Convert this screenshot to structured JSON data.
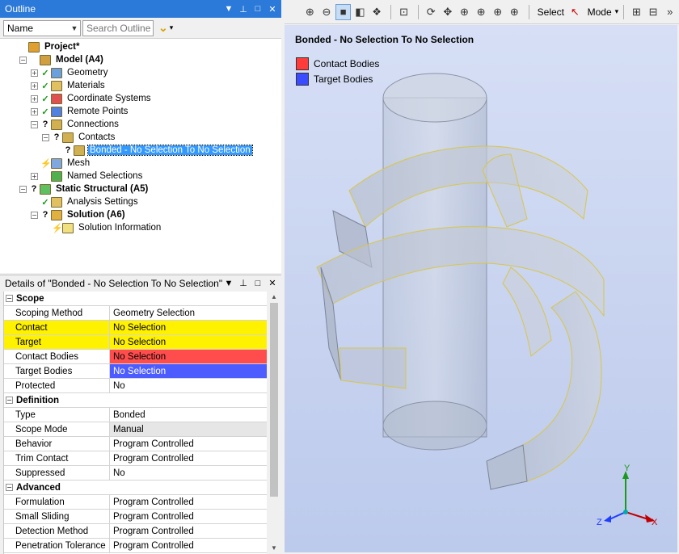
{
  "outline": {
    "title": "Outline",
    "pin_icon": "pin-icon",
    "filter_select": "Name",
    "search_placeholder": "Search Outline",
    "tree": [
      {
        "label": "Project*",
        "level": 0,
        "expander": "",
        "status": "",
        "icon": "project-icon",
        "bold": true
      },
      {
        "label": "Model (A4)",
        "level": 1,
        "expander": "−",
        "status": "",
        "icon": "model-icon",
        "bold": true
      },
      {
        "label": "Geometry",
        "level": 2,
        "expander": "+",
        "status": "✓",
        "icon": "geometry-icon"
      },
      {
        "label": "Materials",
        "level": 2,
        "expander": "+",
        "status": "✓",
        "icon": "materials-icon"
      },
      {
        "label": "Coordinate Systems",
        "level": 2,
        "expander": "+",
        "status": "✓",
        "icon": "coordinate-systems-icon"
      },
      {
        "label": "Remote Points",
        "level": 2,
        "expander": "+",
        "status": "✓",
        "icon": "remote-points-icon"
      },
      {
        "label": "Connections",
        "level": 2,
        "expander": "−",
        "status": "?",
        "icon": "connections-icon"
      },
      {
        "label": "Contacts",
        "level": 3,
        "expander": "−",
        "status": "?",
        "icon": "contacts-icon"
      },
      {
        "label": "Bonded - No Selection To No Selection",
        "level": 4,
        "expander": "",
        "status": "?",
        "icon": "bonded-contact-icon",
        "selected": true
      },
      {
        "label": "Mesh",
        "level": 2,
        "expander": "",
        "status": "⚡",
        "icon": "mesh-icon"
      },
      {
        "label": "Named Selections",
        "level": 2,
        "expander": "+",
        "status": "",
        "icon": "named-selections-icon"
      },
      {
        "label": "Static Structural (A5)",
        "level": 1,
        "expander": "−",
        "status": "?",
        "icon": "static-structural-icon",
        "bold": true
      },
      {
        "label": "Analysis Settings",
        "level": 2,
        "expander": "",
        "status": "✓",
        "icon": "analysis-settings-icon"
      },
      {
        "label": "Solution (A6)",
        "level": 2,
        "expander": "−",
        "status": "?",
        "icon": "solution-icon",
        "bold": true
      },
      {
        "label": "Solution Information",
        "level": 3,
        "expander": "",
        "status": "⚡",
        "icon": "solution-information-icon"
      }
    ]
  },
  "details": {
    "title": "Details of \"Bonded - No Selection To No Selection\"",
    "rows": [
      {
        "type": "cat",
        "label": "Scope"
      },
      {
        "key": "Scoping Method",
        "value": "Geometry Selection"
      },
      {
        "key": "Contact",
        "value": "No Selection",
        "style": "yellow"
      },
      {
        "key": "Target",
        "value": "No Selection",
        "style": "yellow"
      },
      {
        "key": "Contact Bodies",
        "value": "No Selection",
        "style": "red"
      },
      {
        "key": "Target Bodies",
        "value": "No Selection",
        "style": "blue"
      },
      {
        "key": "Protected",
        "value": "No"
      },
      {
        "type": "cat",
        "label": "Definition"
      },
      {
        "key": "Type",
        "value": "Bonded"
      },
      {
        "key": "Scope Mode",
        "value": "Manual",
        "style": "grey"
      },
      {
        "key": "Behavior",
        "value": "Program Controlled"
      },
      {
        "key": "Trim Contact",
        "value": "Program Controlled"
      },
      {
        "key": "Suppressed",
        "value": "No"
      },
      {
        "type": "cat",
        "label": "Advanced"
      },
      {
        "key": "Formulation",
        "value": "Program Controlled"
      },
      {
        "key": "Small Sliding",
        "value": "Program Controlled"
      },
      {
        "key": "Detection Method",
        "value": "Program Controlled"
      },
      {
        "key": "Penetration Tolerance",
        "value": "Program Controlled"
      }
    ]
  },
  "graphics_toolbar": {
    "select_label": "Select",
    "mode_label": "Mode"
  },
  "viewport": {
    "title": "Bonded - No Selection To No Selection",
    "legend": [
      {
        "label": "Contact Bodies",
        "color": "#ff3b3b"
      },
      {
        "label": "Target Bodies",
        "color": "#3b4bff"
      }
    ],
    "triad": {
      "x": "X",
      "y": "Y",
      "z": "Z"
    }
  },
  "colors": {
    "accent_title": "#2b79d8",
    "highlight_yellow": "#fff200",
    "contact_red": "#ff4d4d",
    "target_blue": "#4d5cff"
  }
}
